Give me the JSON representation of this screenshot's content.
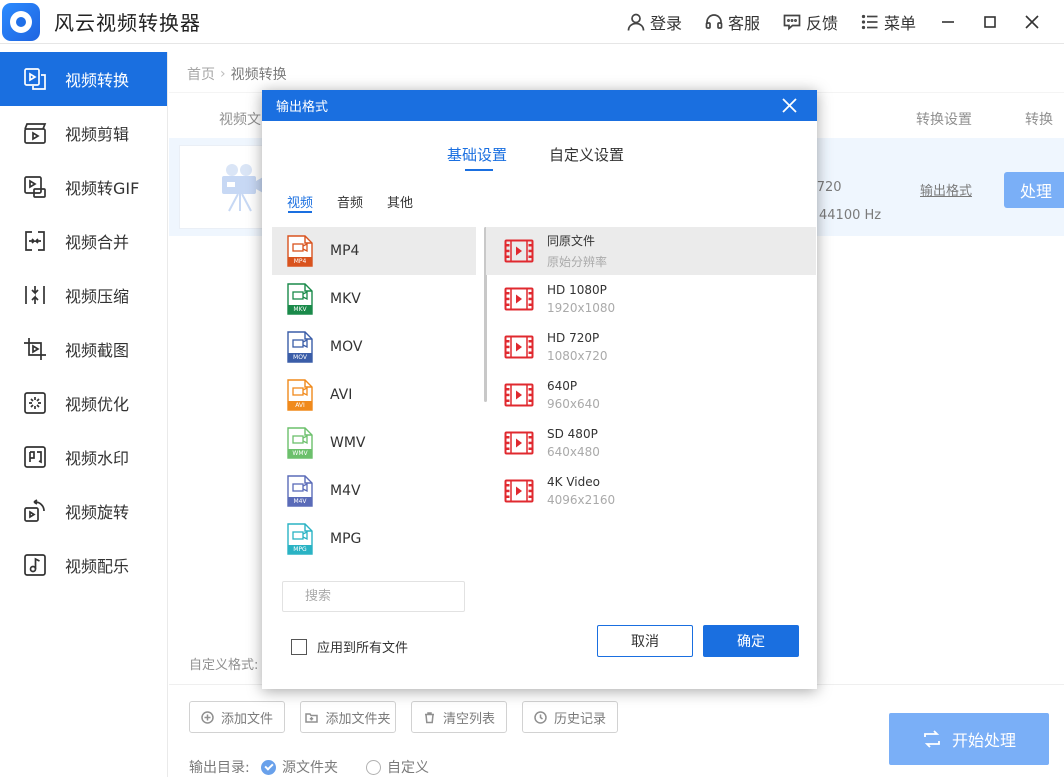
{
  "app": {
    "title": "风云视频转换器"
  },
  "header_actions": [
    {
      "label": "登录",
      "icon": "user-icon"
    },
    {
      "label": "客服",
      "icon": "headset-icon"
    },
    {
      "label": "反馈",
      "icon": "feedback-icon"
    },
    {
      "label": "菜单",
      "icon": "menu-icon"
    }
  ],
  "sidebar": {
    "items": [
      {
        "label": "视频转换",
        "active": true
      },
      {
        "label": "视频剪辑"
      },
      {
        "label": "视频转GIF"
      },
      {
        "label": "视频合并"
      },
      {
        "label": "视频压缩"
      },
      {
        "label": "视频截图"
      },
      {
        "label": "视频优化"
      },
      {
        "label": "视频水印"
      },
      {
        "label": "视频旋转"
      },
      {
        "label": "视频配乐"
      }
    ]
  },
  "breadcrumb": {
    "home": "首页",
    "current": "视频转换"
  },
  "table": {
    "headers": {
      "video_file": "视频文",
      "settings": "转换设置",
      "convert": "转换"
    },
    "row": {
      "resolution": "x720",
      "audio_rate": "44100 Hz",
      "format_link": "输出格式",
      "process_label": "处理"
    }
  },
  "custom_format_label": "自定义格式:",
  "bottom": {
    "add_file": "添加文件",
    "add_folder": "添加文件夹",
    "clear_list": "清空列表",
    "history": "历史记录",
    "output_dir_label": "输出目录:",
    "source_folder": "源文件夹",
    "custom": "自定义",
    "start": "开始处理"
  },
  "dialog": {
    "title": "输出格式",
    "tabs": {
      "basic": "基础设置",
      "custom": "自定义设置"
    },
    "subtabs": {
      "video": "视频",
      "audio": "音频",
      "other": "其他"
    },
    "formats": [
      {
        "name": "MP4",
        "color": "#d9531e"
      },
      {
        "name": "MKV",
        "color": "#1a8a4a"
      },
      {
        "name": "MOV",
        "color": "#3a5da8"
      },
      {
        "name": "AVI",
        "color": "#f08a1c"
      },
      {
        "name": "WMV",
        "color": "#6cc06c"
      },
      {
        "name": "M4V",
        "color": "#5a6bb8"
      },
      {
        "name": "MPG",
        "color": "#2ab3c4"
      }
    ],
    "resolutions": [
      {
        "name": "同原文件",
        "sub": "原始分辨率"
      },
      {
        "name": "HD 1080P",
        "sub": "1920x1080"
      },
      {
        "name": "HD 720P",
        "sub": "1080x720"
      },
      {
        "name": "640P",
        "sub": "960x640"
      },
      {
        "name": "SD 480P",
        "sub": "640x480"
      },
      {
        "name": "4K Video",
        "sub": "4096x2160"
      }
    ],
    "search_placeholder": "搜索",
    "apply_all": "应用到所有文件",
    "cancel": "取消",
    "ok": "确定"
  },
  "colors": {
    "accent": "#1a6fe0",
    "process_button": "#3484f3",
    "row_highlight": "#e6f1fe",
    "film_icon": "#e0292f"
  }
}
